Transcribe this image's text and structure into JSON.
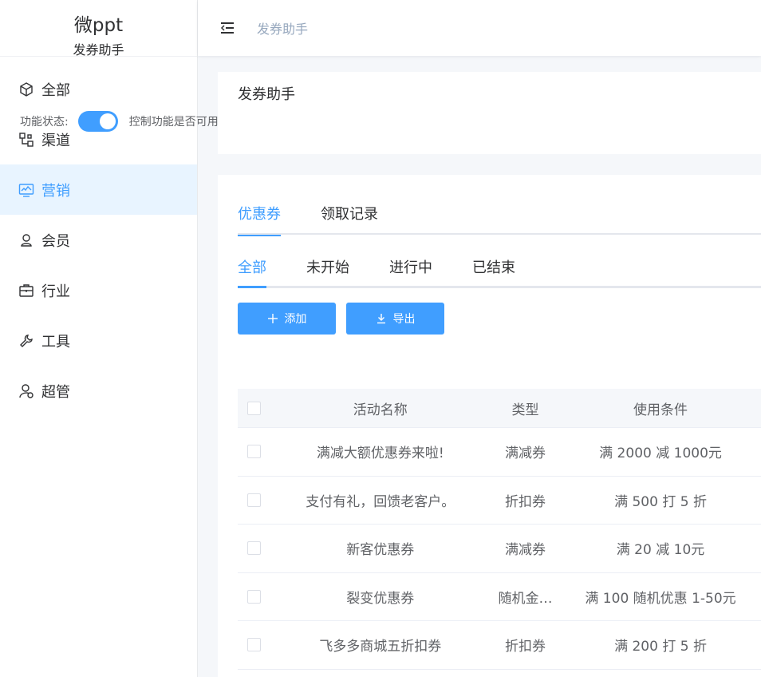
{
  "brand": {
    "title": "微ppt",
    "subtitle": "发券助手"
  },
  "sidebar": {
    "items": [
      {
        "label": "全部",
        "icon": "box-icon",
        "active": false
      },
      {
        "label": "渠道",
        "icon": "channel-icon",
        "active": false
      },
      {
        "label": "营销",
        "icon": "monitor-chart-icon",
        "active": true
      },
      {
        "label": "会员",
        "icon": "user-icon",
        "active": false
      },
      {
        "label": "行业",
        "icon": "briefcase-icon",
        "active": false
      },
      {
        "label": "工具",
        "icon": "wrench-icon",
        "active": false
      },
      {
        "label": "超管",
        "icon": "admin-user-icon",
        "active": false
      }
    ]
  },
  "header": {
    "title": "发券助手"
  },
  "feature": {
    "title": "发券助手",
    "status_label": "功能状态:",
    "enabled": true,
    "status_desc": "控制功能是否可用"
  },
  "tabs": [
    {
      "label": "优惠券",
      "active": true
    },
    {
      "label": "领取记录",
      "active": false
    }
  ],
  "subtabs": [
    {
      "label": "全部",
      "active": true
    },
    {
      "label": "未开始",
      "active": false
    },
    {
      "label": "进行中",
      "active": false
    },
    {
      "label": "已结束",
      "active": false
    }
  ],
  "buttons": {
    "add": "添加",
    "export": "导出"
  },
  "table": {
    "columns": [
      "活动名称",
      "类型",
      "使用条件"
    ],
    "rows": [
      {
        "name": "满减大额优惠券来啦!",
        "type": "满减券",
        "condition": "满 2000 减 1000元"
      },
      {
        "name": "支付有礼，回馈老客户。",
        "type": "折扣券",
        "condition": "满 500 打 5 折"
      },
      {
        "name": "新客优惠券",
        "type": "满减券",
        "condition": "满 20 减 10元"
      },
      {
        "name": "裂变优惠券",
        "type": "随机金…",
        "condition": "满 100 随机优惠 1-50元"
      },
      {
        "name": "飞多多商城五折扣券",
        "type": "折扣券",
        "condition": "满 200 打 5 折"
      }
    ]
  },
  "colors": {
    "primary": "#409eff",
    "active_bg": "#e8f4ff",
    "text": "#303133"
  }
}
